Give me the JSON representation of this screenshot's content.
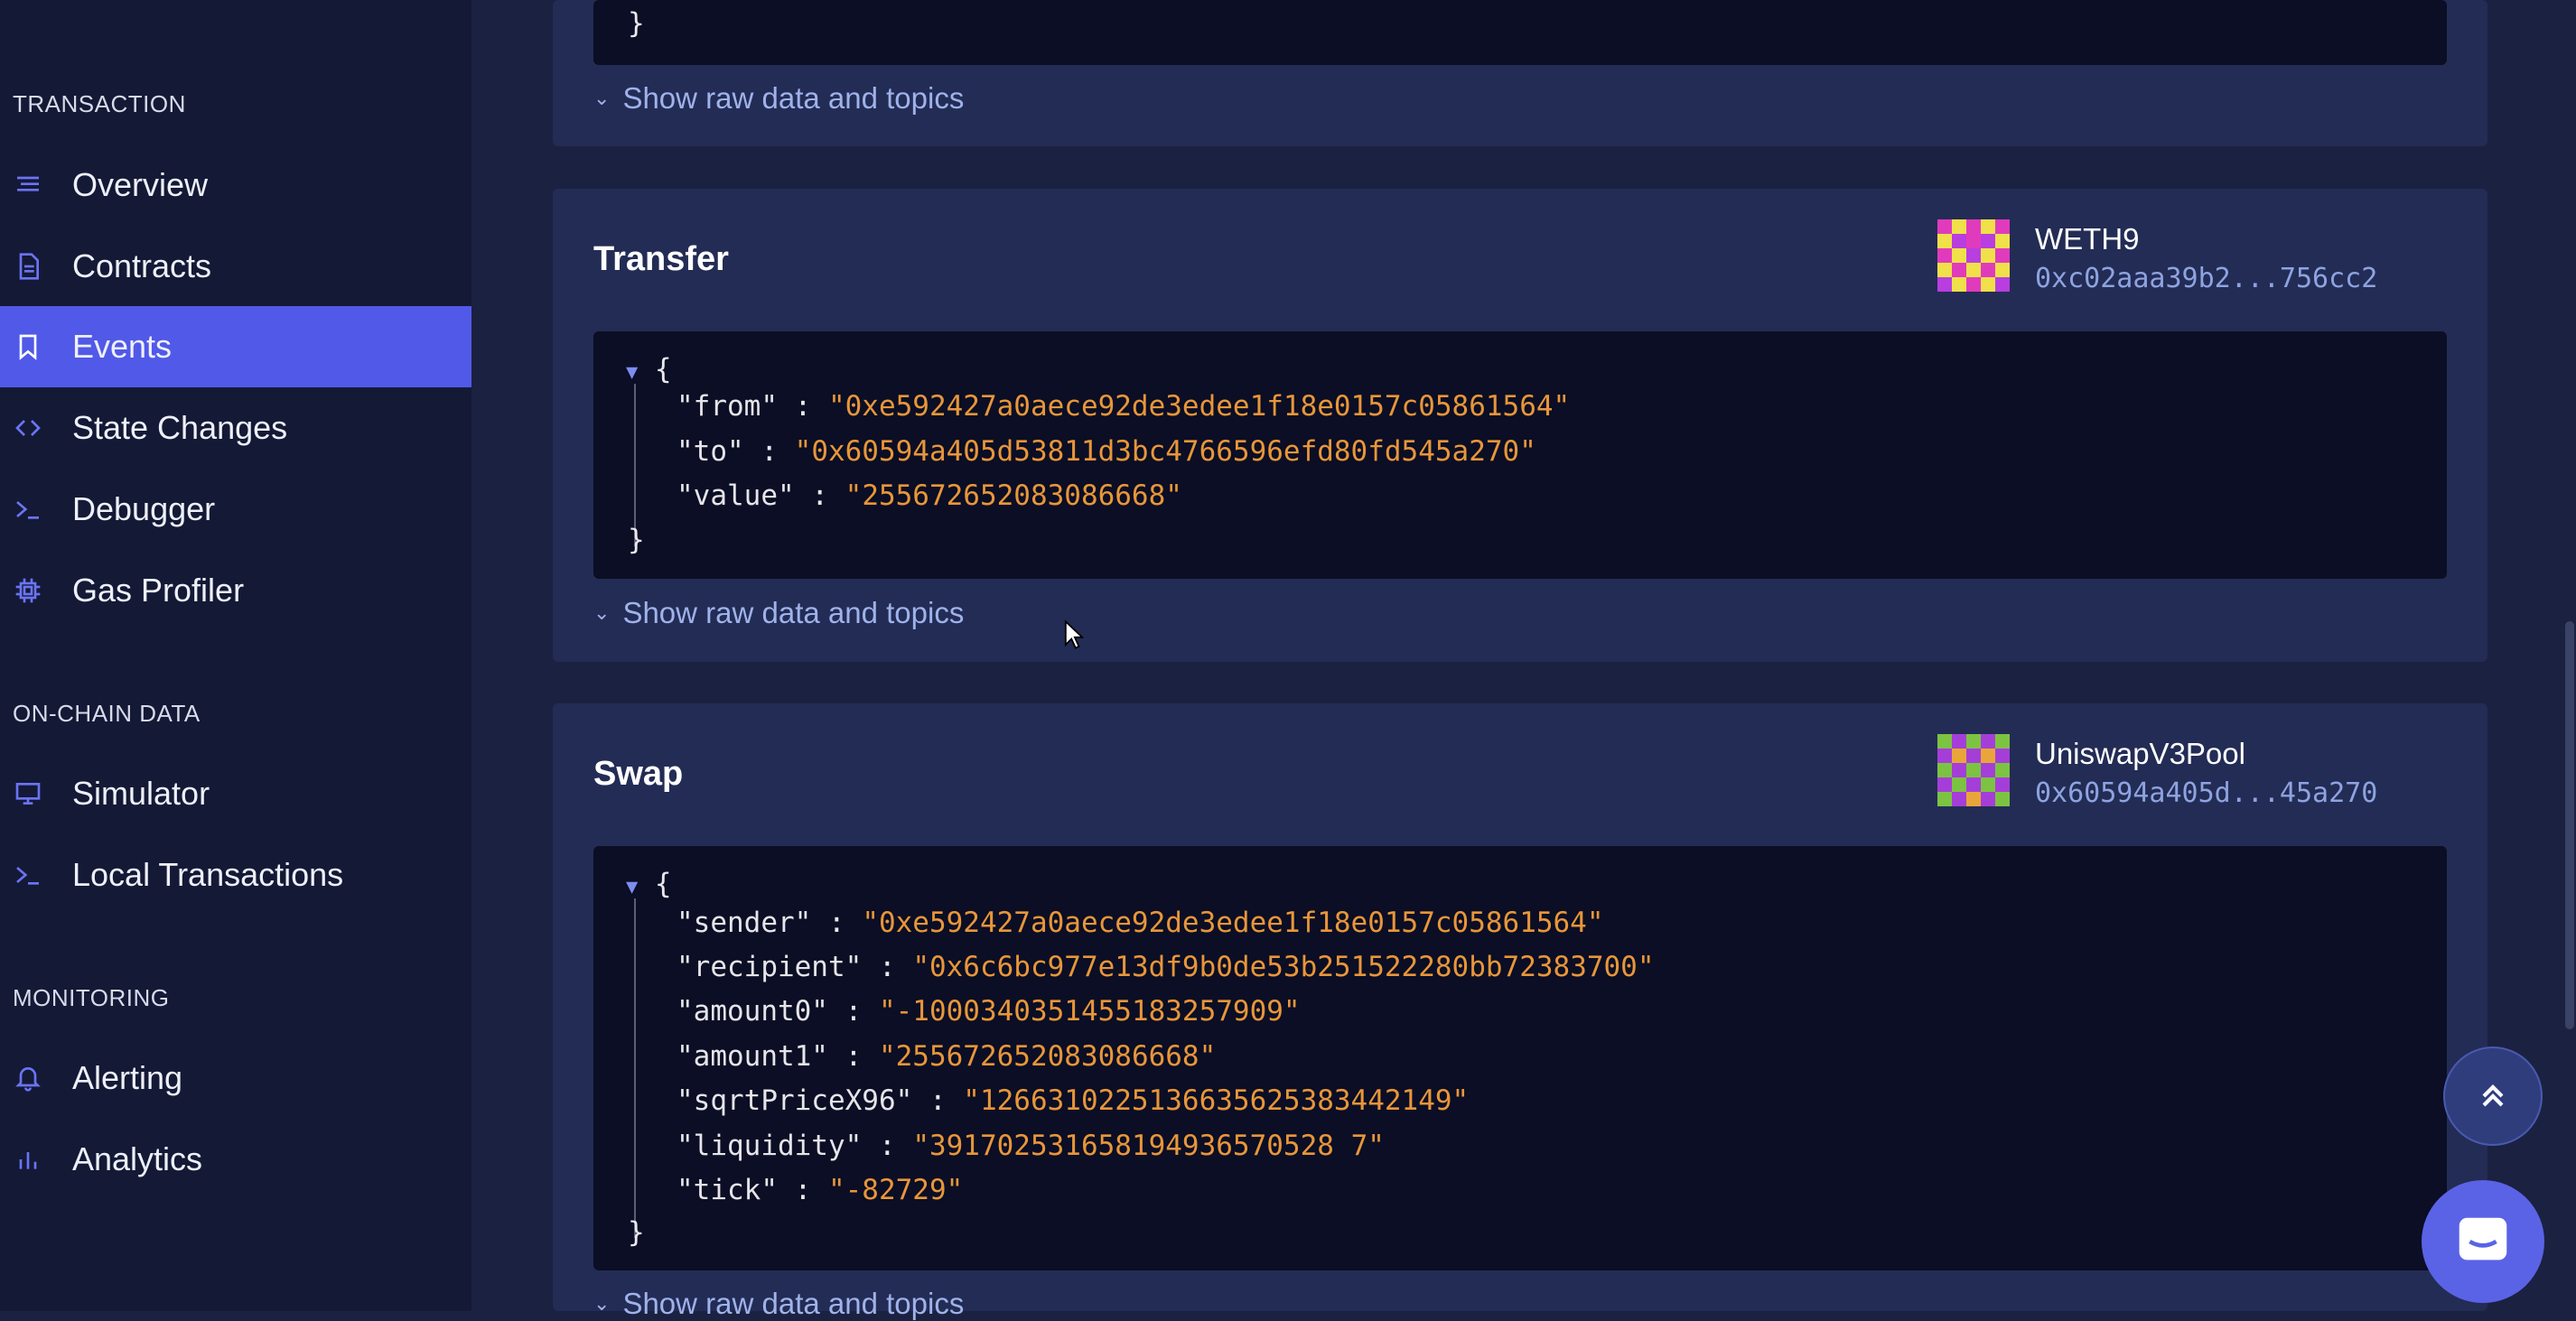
{
  "sidebar": {
    "sections": [
      {
        "title": "TRANSACTION",
        "items": [
          {
            "label": "Overview",
            "icon": "list-icon"
          },
          {
            "label": "Contracts",
            "icon": "document-icon"
          },
          {
            "label": "Events",
            "icon": "bookmark-icon",
            "active": true
          },
          {
            "label": "State Changes",
            "icon": "code-icon"
          },
          {
            "label": "Debugger",
            "icon": "terminal-icon"
          },
          {
            "label": "Gas Profiler",
            "icon": "chip-icon"
          }
        ]
      },
      {
        "title": "ON-CHAIN DATA",
        "items": [
          {
            "label": "Simulator",
            "icon": "monitor-icon"
          },
          {
            "label": "Local Transactions",
            "icon": "terminal-icon"
          }
        ]
      },
      {
        "title": "MONITORING",
        "items": [
          {
            "label": "Alerting",
            "icon": "bell-icon"
          },
          {
            "label": "Analytics",
            "icon": "bar-chart-icon"
          }
        ]
      }
    ]
  },
  "events": {
    "toggle_label": "Show raw data and topics",
    "prev": {
      "closing_brace": "}"
    },
    "transfer": {
      "title": "Transfer",
      "contract_name": "WETH9",
      "contract_addr": "0xc02aaa39b2...756cc2",
      "open_brace": "{",
      "closing_brace": "}",
      "fields": [
        {
          "key": "\"from\"",
          "value": "\"0xe592427a0aece92de3edee1f18e0157c05861564\""
        },
        {
          "key": "\"to\"",
          "value": "\"0x60594a405d53811d3bc4766596efd80fd545a270\""
        },
        {
          "key": "\"value\"",
          "value": "\"255672652083086668\""
        }
      ]
    },
    "swap": {
      "title": "Swap",
      "contract_name": "UniswapV3Pool",
      "contract_addr": "0x60594a405d...45a270",
      "open_brace": "{",
      "closing_brace": "}",
      "fields": [
        {
          "key": "\"sender\"",
          "value": "\"0xe592427a0aece92de3edee1f18e0157c05861564\""
        },
        {
          "key": "\"recipient\"",
          "value": "\"0x6c6bc977e13df9b0de53b251522280bb72383700\""
        },
        {
          "key": "\"amount0\"",
          "value": "\"-1000340351455183257909\""
        },
        {
          "key": "\"amount1\"",
          "value": "\"255672652083086668\""
        },
        {
          "key": "\"sqrtPriceX96\"",
          "value": "\"1266310225136635625383442149\""
        },
        {
          "key": "\"liquidity\"",
          "value": "\"391702531658194936570528 7\""
        },
        {
          "key": "\"tick\"",
          "value": "\"-82729\""
        }
      ]
    }
  },
  "colors": {
    "accent": "#5159e8",
    "string": "#e8963a",
    "link": "#9fb2ea"
  }
}
